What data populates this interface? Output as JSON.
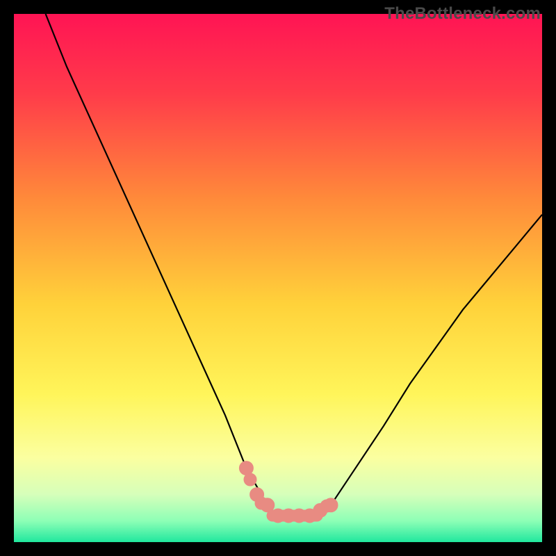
{
  "watermark": "TheBottleneck.com",
  "chart_data": {
    "type": "line",
    "title": "",
    "xlabel": "",
    "ylabel": "",
    "xlim": [
      0,
      100
    ],
    "ylim": [
      0,
      100
    ],
    "grid": false,
    "legend": false,
    "series": [
      {
        "name": "curve",
        "x": [
          6,
          10,
          15,
          20,
          25,
          30,
          35,
          40,
          44,
          48,
          50,
          54,
          58,
          60,
          64,
          70,
          75,
          80,
          85,
          90,
          95,
          100
        ],
        "values": [
          100,
          90,
          79,
          68,
          57,
          46,
          35,
          24,
          14,
          7,
          5,
          5,
          6,
          7,
          13,
          22,
          30,
          37,
          44,
          50,
          56,
          62
        ]
      }
    ],
    "markers": {
      "name": "bottleneck-zone",
      "color": "#e88b82",
      "x": [
        44,
        46,
        48,
        50,
        52,
        54,
        56,
        58,
        60
      ],
      "values": [
        14,
        9,
        7,
        5,
        5,
        5,
        5,
        6,
        7
      ]
    },
    "background_gradient": {
      "stops": [
        {
          "pos": 0.0,
          "color": "#ff1454"
        },
        {
          "pos": 0.15,
          "color": "#ff3b4a"
        },
        {
          "pos": 0.35,
          "color": "#ff8a3a"
        },
        {
          "pos": 0.55,
          "color": "#ffd23a"
        },
        {
          "pos": 0.72,
          "color": "#fff55a"
        },
        {
          "pos": 0.84,
          "color": "#fbffa0"
        },
        {
          "pos": 0.91,
          "color": "#d6ffba"
        },
        {
          "pos": 0.96,
          "color": "#8dffb6"
        },
        {
          "pos": 1.0,
          "color": "#20e79e"
        }
      ]
    }
  }
}
